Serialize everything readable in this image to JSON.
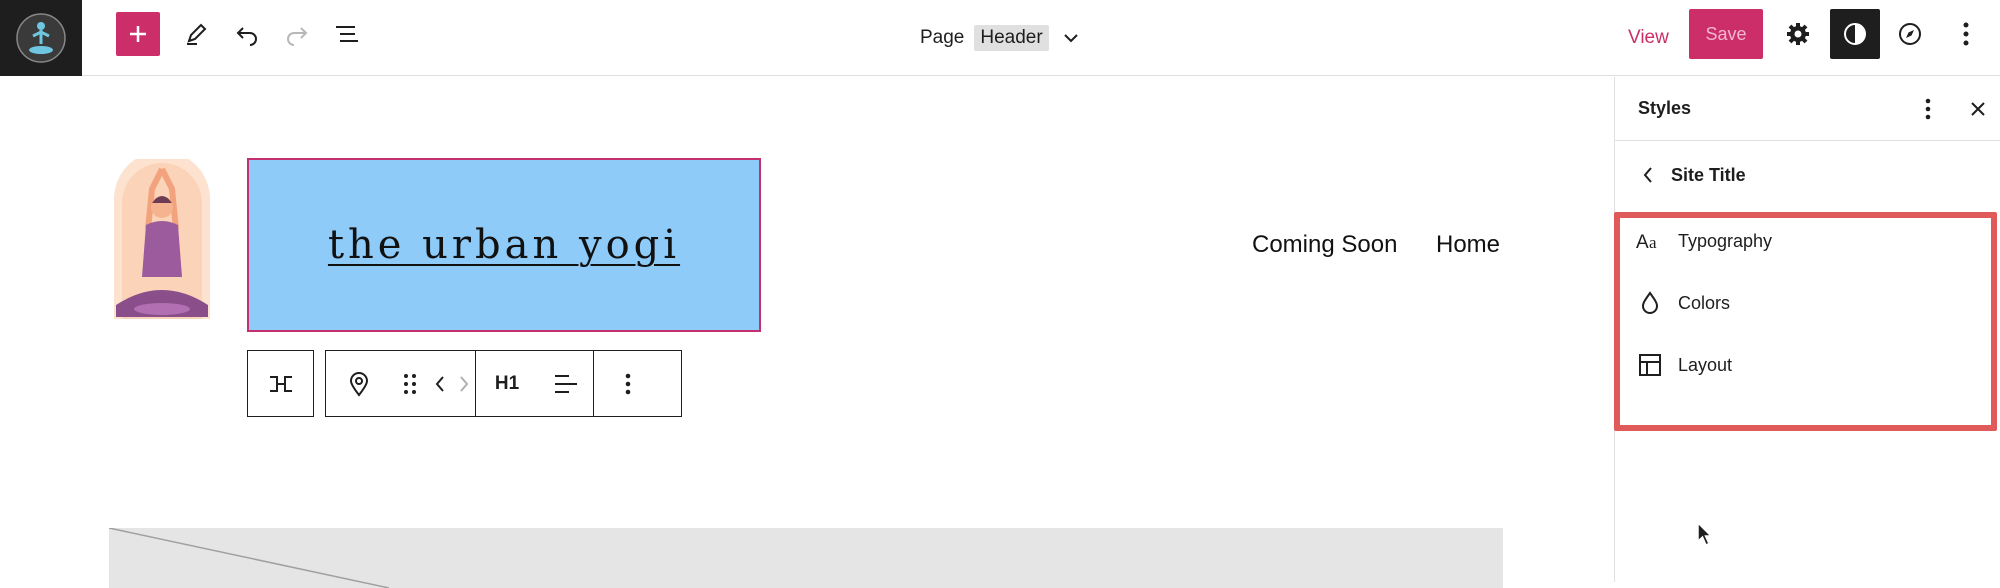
{
  "topbar": {
    "document_type": "Page",
    "document_name": "Header",
    "view_label": "View",
    "save_label": "Save"
  },
  "canvas": {
    "site_title": "the urban yogi",
    "nav_items": [
      "Coming Soon",
      "Home"
    ],
    "block_toolbar": {
      "heading_level": "H1"
    }
  },
  "sidebar": {
    "title": "Styles",
    "section_title": "Site Title",
    "menu_items": [
      {
        "label": "Typography",
        "icon": "typography-icon"
      },
      {
        "label": "Colors",
        "icon": "droplet-icon"
      },
      {
        "label": "Layout",
        "icon": "layout-icon"
      }
    ]
  },
  "colors": {
    "accent": "#cc2e6a",
    "title_background": "#8ecbf9",
    "highlight": "#e05a5a"
  }
}
